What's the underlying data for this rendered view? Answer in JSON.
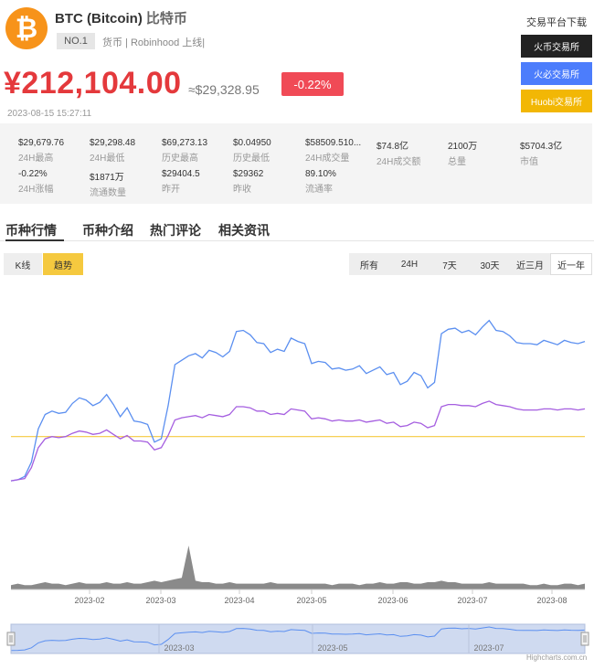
{
  "coin": {
    "logo_glyph": "₿",
    "symbol_name": "BTC (Bitcoin)",
    "cn_name": "比特币",
    "rank": "NO.1",
    "tags": "货币 | Robinhood 上线|"
  },
  "price": {
    "cny": "¥212,104.00",
    "usd": "≈$29,328.95",
    "change": "-0.22%",
    "timestamp": "2023-08-15 15:27:11"
  },
  "exchanges": {
    "title": "交易平台下载",
    "buttons": [
      "火币交易所",
      "火必交易所",
      "Huobi交易所"
    ],
    "colors": [
      "#222222",
      "#4c7dfc",
      "#f2b705"
    ]
  },
  "stats": [
    {
      "value": "$29,679.76",
      "label": "24H最高"
    },
    {
      "value": "$29,298.48",
      "label": "24H最低"
    },
    {
      "value": "$69,273.13",
      "label": "历史最高"
    },
    {
      "value": "$0.04950",
      "label": "历史最低"
    },
    {
      "value": "$58509.510...",
      "label": "24H成交量"
    },
    {
      "value": "$74.8亿",
      "label": "24H成交额"
    },
    {
      "value": "2100万",
      "label": "总量"
    },
    {
      "value": "$5704.3亿",
      "label": "市值"
    },
    {
      "value": "-0.22%",
      "label": "24H涨幅"
    },
    {
      "value": "$1871万",
      "label": "流通数量"
    },
    {
      "value": "$29404.5",
      "label": "昨开"
    },
    {
      "value": "$29362",
      "label": "昨收"
    },
    {
      "value": "89.10%",
      "label": "流通率"
    }
  ],
  "tabs": [
    "币种行情",
    "币种介绍",
    "热门评论",
    "相关资讯"
  ],
  "chart_modes": [
    "K线",
    "趋势"
  ],
  "ranges": [
    "所有",
    "24H",
    "7天",
    "30天",
    "近三月",
    "近一年"
  ],
  "active_range": "近一年",
  "chart_data": {
    "type": "line",
    "x_ticks": [
      "2023-02",
      "2023-03",
      "2023-04",
      "2023-05",
      "2023-06",
      "2023-07",
      "2023-08"
    ],
    "navigator_ticks": [
      "2023-03",
      "2023-05",
      "2023-07"
    ],
    "series": [
      {
        "color": "#5b8ff0",
        "values": [
          16800,
          16900,
          17200,
          18500,
          21500,
          22800,
          23100,
          22900,
          23000,
          23800,
          24300,
          24100,
          23600,
          23900,
          24600,
          23700,
          22600,
          23400,
          22200,
          22100,
          21900,
          20300,
          20600,
          23600,
          27300,
          27700,
          28100,
          28300,
          27900,
          28600,
          28400,
          28000,
          28500,
          30300,
          30400,
          30000,
          29300,
          29200,
          28400,
          28700,
          28500,
          29700,
          29400,
          29200,
          27400,
          27600,
          27500,
          26900,
          27000,
          26800,
          26900,
          27200,
          26500,
          26800,
          27100,
          26400,
          26600,
          25500,
          25800,
          26600,
          26300,
          25200,
          25700,
          30100,
          30500,
          30600,
          30200,
          30400,
          30000,
          30700,
          31300,
          30400,
          30300,
          29900,
          29300,
          29200,
          29200,
          29100,
          29500,
          29300,
          29100,
          29500,
          29300,
          29200,
          29400
        ]
      },
      {
        "color": "#a55ee0",
        "values": [
          16800,
          16900,
          17000,
          18000,
          19800,
          20600,
          20800,
          20700,
          20800,
          21100,
          21300,
          21200,
          21000,
          21100,
          21400,
          21000,
          20600,
          20900,
          20400,
          20400,
          20300,
          19600,
          19800,
          20900,
          22300,
          22500,
          22600,
          22700,
          22500,
          22800,
          22700,
          22600,
          22800,
          23500,
          23500,
          23400,
          23100,
          23100,
          22800,
          22900,
          22800,
          23300,
          23200,
          23100,
          22400,
          22500,
          22400,
          22200,
          22300,
          22200,
          22200,
          22300,
          22100,
          22200,
          22300,
          22000,
          22100,
          21700,
          21800,
          22100,
          22000,
          21600,
          21800,
          23500,
          23700,
          23700,
          23600,
          23600,
          23500,
          23800,
          24000,
          23700,
          23600,
          23500,
          23300,
          23200,
          23200,
          23200,
          23300,
          23300,
          23200,
          23300,
          23300,
          23200,
          23300
        ]
      }
    ],
    "reference_line": {
      "color": "#f5c93f",
      "value": 20800
    },
    "volume": [
      3,
      4,
      3,
      3,
      4,
      5,
      4,
      4,
      3,
      4,
      5,
      4,
      4,
      4,
      5,
      4,
      4,
      5,
      4,
      4,
      5,
      6,
      5,
      6,
      7,
      8,
      30,
      6,
      5,
      5,
      4,
      4,
      5,
      4,
      4,
      4,
      4,
      4,
      5,
      4,
      4,
      4,
      4,
      4,
      4,
      4,
      4,
      3,
      4,
      4,
      4,
      3,
      4,
      4,
      5,
      4,
      4,
      5,
      5,
      4,
      4,
      5,
      5,
      6,
      5,
      5,
      4,
      4,
      4,
      4,
      5,
      4,
      4,
      4,
      4,
      4,
      3,
      3,
      4,
      3,
      3,
      4,
      4,
      3,
      4
    ],
    "credit": "Highcharts.com.cn"
  }
}
